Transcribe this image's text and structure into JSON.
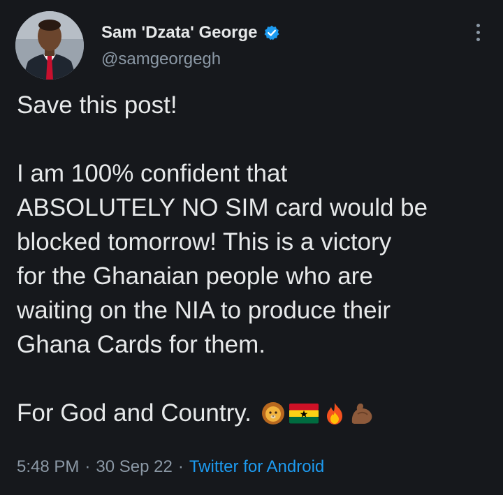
{
  "author": {
    "display_name": "Sam 'Dzata' George",
    "handle": "@samgeorgegh",
    "verified": true
  },
  "body": {
    "lines": [
      "Save this post!",
      "",
      "I am 100% confident that",
      "ABSOLUTELY NO SIM card would be",
      "blocked tomorrow! This is a victory",
      "for the Ghanaian people who are",
      "waiting on the NIA to produce their",
      "Ghana Cards for them.",
      "",
      "For God and Country."
    ],
    "emojis": [
      "lion-face-icon",
      "ghana-flag-icon",
      "fire-icon",
      "flexed-biceps-icon"
    ]
  },
  "meta": {
    "time": "5:48 PM",
    "separator": "·",
    "date": "30 Sep 22",
    "source": "Twitter for Android"
  },
  "colors": {
    "background": "#16181c",
    "text": "#e7e9ea",
    "secondary_text": "#8b98a5",
    "link": "#1d9bf0",
    "verified_badge": "#1d9bf0"
  }
}
